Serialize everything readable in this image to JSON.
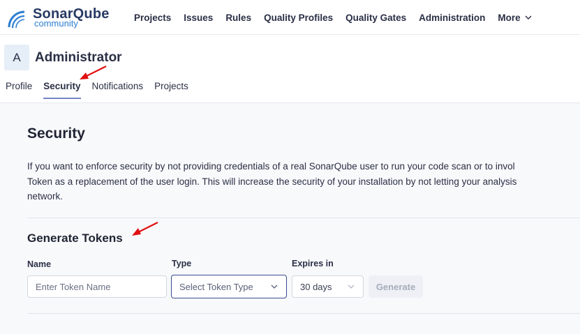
{
  "brand": {
    "name": "SonarQube",
    "edition": "community"
  },
  "nav": {
    "items": [
      "Projects",
      "Issues",
      "Rules",
      "Quality Profiles",
      "Quality Gates",
      "Administration"
    ],
    "more_label": "More"
  },
  "user": {
    "avatar_letter": "A",
    "name": "Administrator",
    "tabs": [
      "Profile",
      "Security",
      "Notifications",
      "Projects"
    ],
    "active_tab": "Security"
  },
  "security": {
    "title": "Security",
    "description_lines": [
      "If you want to enforce security by not providing credentials of a real SonarQube user to run your code scan or to invol",
      "Token as a replacement of the user login. This will increase the security of your installation by not letting your analysis",
      "network."
    ],
    "generate": {
      "title": "Generate Tokens",
      "name_label": "Name",
      "name_placeholder": "Enter Token Name",
      "type_label": "Type",
      "type_placeholder": "Select Token Type",
      "expires_label": "Expires in",
      "expires_value": "30 days",
      "button_label": "Generate"
    }
  },
  "colors": {
    "logo_dark": "#273a63",
    "logo_blue": "#2d7fd1",
    "active_tab_underline": "#7384c6",
    "focused_border": "#3a4a8e",
    "annotation_arrow": "#e01010"
  }
}
